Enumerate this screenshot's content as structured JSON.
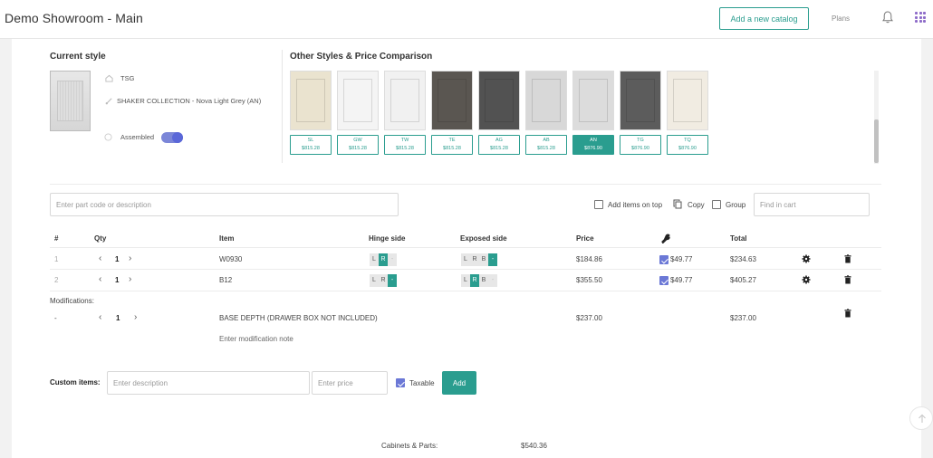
{
  "header": {
    "title": "Demo Showroom - Main",
    "add_catalog_label": "Add a new catalog",
    "plans_label": "Plans"
  },
  "current_style": {
    "section_title": "Current style",
    "brand": "TSG",
    "collection": "SHAKER COLLECTION - Nova Light Grey (AN)",
    "assembled_label": "Assembled",
    "assembled_on": true
  },
  "other_styles": {
    "section_title": "Other Styles & Price Comparison",
    "items": [
      {
        "code": "SL",
        "price": "$815.28",
        "color": "#eae3cf",
        "active": false
      },
      {
        "code": "GW",
        "price": "$815.28",
        "color": "#f4f4f4",
        "active": false
      },
      {
        "code": "TW",
        "price": "$815.28",
        "color": "#f1f1f1",
        "active": false
      },
      {
        "code": "TE",
        "price": "$815.28",
        "color": "#5a5651",
        "active": false
      },
      {
        "code": "AG",
        "price": "$815.28",
        "color": "#525252",
        "active": false
      },
      {
        "code": "AB",
        "price": "$815.28",
        "color": "#d8d8d8",
        "active": false
      },
      {
        "code": "AN",
        "price": "$876.90",
        "color": "#dcdcdc",
        "active": true
      },
      {
        "code": "TG",
        "price": "$876.90",
        "color": "#5c5c5c",
        "active": false
      },
      {
        "code": "TQ",
        "price": "$876.90",
        "color": "#f1ece2",
        "active": false
      }
    ]
  },
  "toolbar": {
    "part_search_placeholder": "Enter part code or description",
    "add_items_on_top_label": "Add items on top",
    "copy_label": "Copy",
    "group_label": "Group",
    "find_in_cart_placeholder": "Find in cart"
  },
  "table": {
    "headers": {
      "num": "#",
      "qty": "Qty",
      "item": "Item",
      "hinge": "Hinge side",
      "exposed": "Exposed side",
      "price": "Price",
      "total": "Total"
    },
    "rows": [
      {
        "num": "1",
        "qty": "1",
        "item": "W0930",
        "price": "$184.86",
        "assembly": "$49.77",
        "total": "$234.63"
      },
      {
        "num": "2",
        "qty": "1",
        "item": "B12",
        "price": "$355.50",
        "assembly": "$49.77",
        "total": "$405.27"
      }
    ],
    "hinge_options": [
      "L",
      "R",
      "-"
    ],
    "exposed_options": [
      "L",
      "R",
      "B",
      "-"
    ]
  },
  "modifications": {
    "label": "Modifications:",
    "row": {
      "num": "-",
      "qty": "1",
      "item": "BASE DEPTH (DRAWER BOX NOT INCLUDED)",
      "price": "$237.00",
      "total": "$237.00"
    },
    "note_placeholder": "Enter modification note"
  },
  "custom_items": {
    "label": "Custom items:",
    "description_placeholder": "Enter description",
    "price_placeholder": "Enter price",
    "taxable_label": "Taxable",
    "add_label": "Add"
  },
  "summary": {
    "cabinets_label": "Cabinets & Parts:",
    "cabinets_value": "$540.36"
  },
  "colors": {
    "accent": "#2a9d8f",
    "check": "#6b78d6",
    "toggle": "#5a67d8",
    "apps": "#8e6cc9"
  }
}
